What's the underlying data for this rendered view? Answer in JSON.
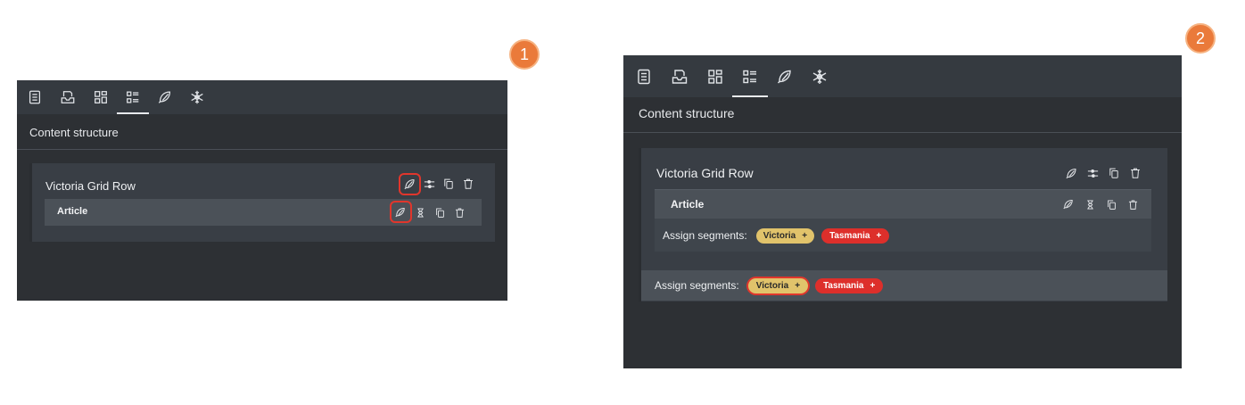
{
  "steps": [
    "1",
    "2"
  ],
  "tabs": [
    {
      "name": "page-tab",
      "icon": "page-icon"
    },
    {
      "name": "template-tab",
      "icon": "inbox-icon"
    },
    {
      "name": "components-tab",
      "icon": "grid-icon"
    },
    {
      "name": "content-structure-tab",
      "icon": "list-icon",
      "active": true
    },
    {
      "name": "segments-tab",
      "icon": "segment-icon"
    },
    {
      "name": "settings-tab",
      "icon": "snowflake-icon"
    }
  ],
  "section_title": "Content structure",
  "grid_row": {
    "title": "Victoria Grid Row",
    "tools": [
      "segment-icon",
      "settings-sliders-icon",
      "copy-icon",
      "trash-icon"
    ]
  },
  "article": {
    "title": "Article",
    "tools": [
      "segment-icon",
      "hourglass-icon",
      "copy-icon",
      "trash-icon"
    ]
  },
  "segments": {
    "label": "Assign segments:",
    "victoria": "Victoria",
    "tasmania": "Tasmania",
    "add_symbol": "+"
  },
  "colors": {
    "panel_bg": "#2d3034",
    "tab_bar": "#353a40",
    "row_bg": "#393e45",
    "child_row_bg": "#4b5158",
    "highlight": "#e0362c",
    "badge": "#ea7a3a",
    "victoria_pill": "#e1c36b",
    "tasmania_pill": "#dd2f2b"
  }
}
